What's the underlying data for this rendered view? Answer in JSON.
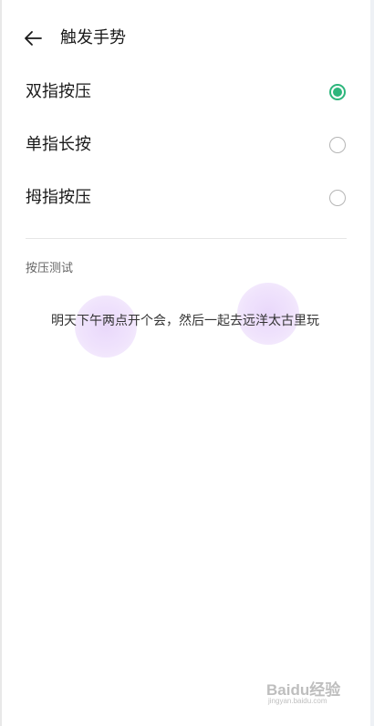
{
  "header": {
    "title": "触发手势",
    "back_icon": "arrow-left-icon"
  },
  "options": [
    {
      "label": "双指按压",
      "selected": true
    },
    {
      "label": "单指长按",
      "selected": false
    },
    {
      "label": "拇指按压",
      "selected": false
    }
  ],
  "test_section": {
    "title": "按压测试",
    "sample_text": "明天下午两点开个会，然后一起去远洋太古里玩"
  },
  "watermark": {
    "brand": "Baidu经验",
    "url": "jingyan.baidu.com"
  },
  "colors": {
    "accent": "#2db67c",
    "touch_indicator": "#e8d6fa",
    "text_primary": "#1a1a1a",
    "text_secondary": "#666666"
  }
}
